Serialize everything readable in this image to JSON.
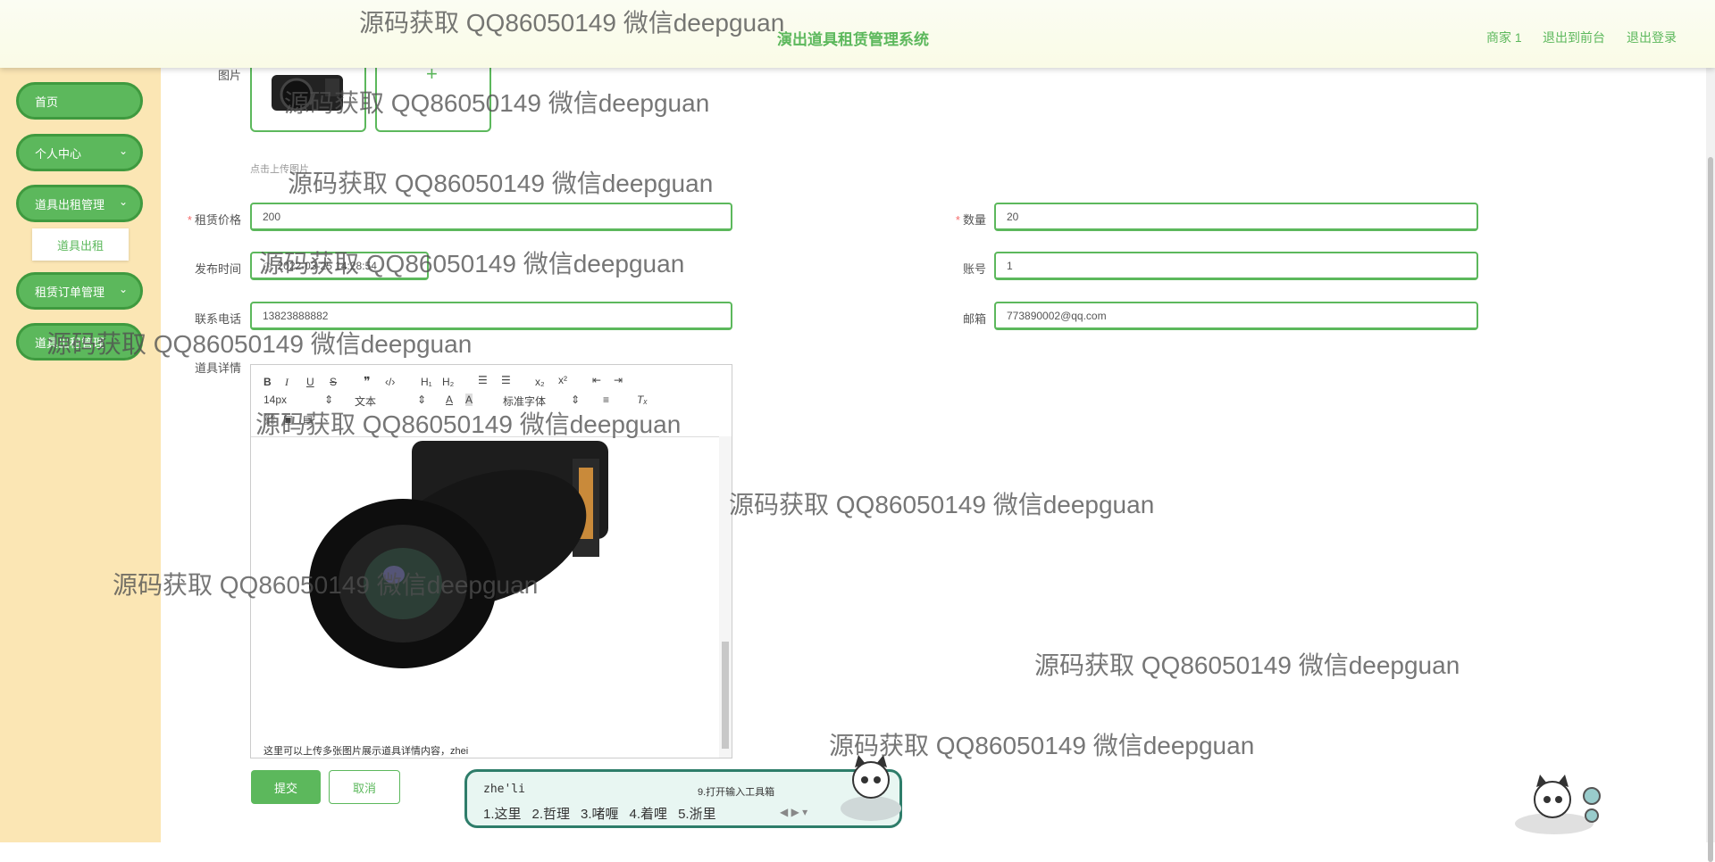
{
  "header": {
    "title": "演出道具租赁管理系统",
    "nav": [
      "商家 1",
      "退出到前台",
      "退出登录"
    ]
  },
  "sidebar": {
    "items": [
      {
        "label": "首页"
      },
      {
        "label": "个人中心"
      },
      {
        "label": "道具出租管理"
      },
      {
        "label": "道具出租"
      },
      {
        "label": "租赁订单管理"
      },
      {
        "label": "道具出租管理"
      }
    ]
  },
  "form": {
    "image_label": "图片",
    "upload_hint": "点击上传图片",
    "price_label": "租赁价格",
    "price_value": "200",
    "quantity_label": "数量",
    "quantity_value": "20",
    "publish_time_label": "发布时间",
    "publish_time_value": "2022-03-25 14:28:54",
    "account_label": "账号",
    "account_value": "1",
    "phone_label": "联系电话",
    "phone_value": "13823888882",
    "email_label": "邮箱",
    "email_value": "773890002@qq.com",
    "details_label": "道具详情",
    "editor": {
      "font_size": "14px",
      "paragraph": "文本",
      "font_family": "标准字体",
      "content": "这里可以上传多张图片展示道具详情内容，zhei"
    },
    "submit_label": "提交",
    "cancel_label": "取消"
  },
  "ime": {
    "composition": "zhe'li",
    "hint": "9.打开输入工具箱",
    "candidates": [
      "1.这里",
      "2.哲理",
      "3.啫喱",
      "4.着哩",
      "5.浙里"
    ]
  },
  "watermark": "源码获取 QQ86050149 微信deepguan",
  "colors": {
    "accent": "#5cb85c",
    "sidebar_bg": "#fbe6b4"
  }
}
